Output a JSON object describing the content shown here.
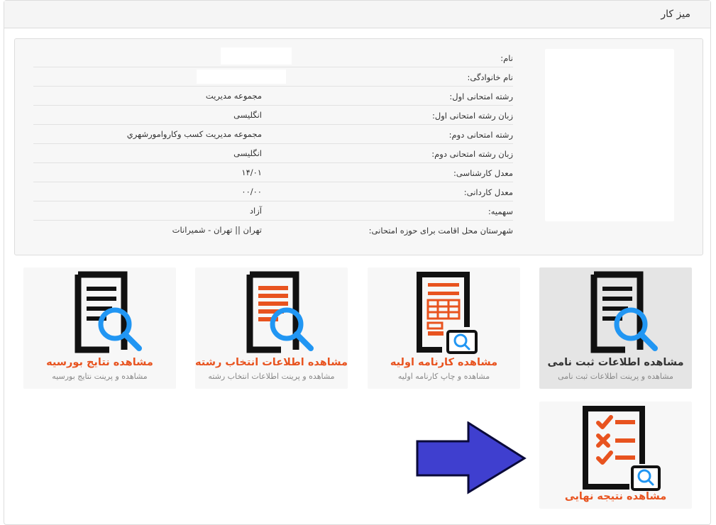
{
  "panel": {
    "title": "میز کار"
  },
  "profile": {
    "rows": [
      {
        "label": "نام:",
        "value": ""
      },
      {
        "label": "نام خانوادگی:",
        "value": ""
      },
      {
        "label": "رشته امتحانی اول:",
        "value": "مجموعه مديريت"
      },
      {
        "label": "زبان رشته امتحانی اول:",
        "value": "انگلیسی"
      },
      {
        "label": "رشته امتحانی دوم:",
        "value": "مجموعه مديريت كسب وكاروامورشهري"
      },
      {
        "label": "زبان رشته امتحانی دوم:",
        "value": "انگلیسی"
      },
      {
        "label": "معدل کارشناسی:",
        "value": "۱۴/۰۱"
      },
      {
        "label": "معدل کاردانی:",
        "value": "۰۰/۰۰"
      },
      {
        "label": "سهمیه:",
        "value": "آزاد"
      },
      {
        "label": "شهرستان محل اقامت برای حوزه امتحانی:",
        "value": "تهران || تهران - شميرانات"
      }
    ]
  },
  "tiles": [
    {
      "title": "مشاهده اطلاعات ثبت نامی",
      "subtitle": "مشاهده و پرینت اطلاعات ثبت نامی",
      "icon": "document-search-icon"
    },
    {
      "title": "مشاهده کارنامه اولیه",
      "subtitle": "مشاهده و چاپ کارنامه اولیه",
      "icon": "report-card-icon"
    },
    {
      "title": "مشاهده اطلاعات انتخاب رشته",
      "subtitle": "مشاهده و پرینت اطلاعات انتخاب رشته",
      "icon": "document-search-icon"
    },
    {
      "title": "مشاهده نتایج بورسیه",
      "subtitle": "مشاهده و پرینت نتایج بورسیه",
      "icon": "document-search-icon"
    },
    {
      "title": "مشاهده نتیجه نهایی",
      "subtitle": "",
      "icon": "checklist-icon"
    }
  ],
  "colors": {
    "accent": "#e8531f",
    "magnifier": "#2196f3",
    "arrow": "#3f3fcf"
  }
}
